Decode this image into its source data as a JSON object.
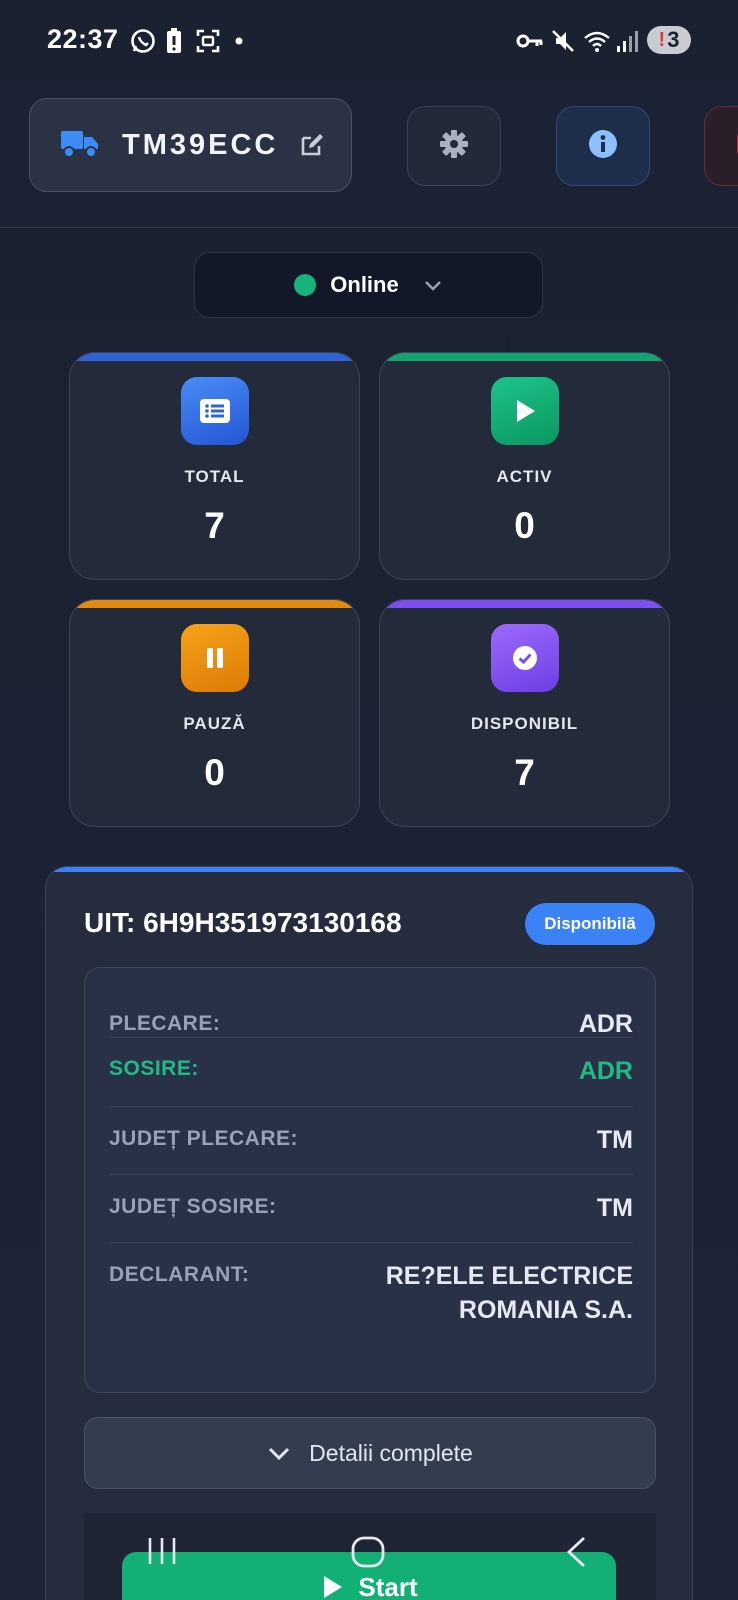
{
  "status_bar": {
    "time": "22:37",
    "notification_count": "3",
    "icons": [
      "whatsapp-icon",
      "battery-saver-icon",
      "screenshot-icon",
      "dot-icon",
      "vpn-key-icon",
      "mute-icon",
      "wifi-icon",
      "signal-icon"
    ]
  },
  "header": {
    "vehicle_plate": "TM39ECC",
    "vehicle_icon": "truck-icon",
    "edit_icon": "edit-icon",
    "settings_icon": "gear-icon",
    "info_icon": "info-icon",
    "logout_icon": "logout-icon"
  },
  "connection": {
    "status_label": "Online",
    "status_color": "#16b37a"
  },
  "stats": [
    {
      "label": "TOTAL",
      "value": "7",
      "color": "#3b82f6",
      "icon": "list-icon"
    },
    {
      "label": "ACTIV",
      "value": "0",
      "color": "#10b981",
      "icon": "play-icon"
    },
    {
      "label": "PAUZĂ",
      "value": "0",
      "color": "#f59e0b",
      "icon": "pause-icon"
    },
    {
      "label": "DISPONIBIL",
      "value": "7",
      "color": "#8b5cf6",
      "icon": "check-circle-icon"
    }
  ],
  "uit_card": {
    "title": "UIT: 6H9H351973130168",
    "badge": "Disponibilă",
    "rows": [
      {
        "label": "PLECARE:",
        "value": "ADR"
      },
      {
        "label": "SOSIRE:",
        "value": "ADR"
      },
      {
        "label": "JUDEȚ PLECARE:",
        "value": "TM"
      },
      {
        "label": "JUDEȚ SOSIRE:",
        "value": "TM"
      },
      {
        "label": "DECLARANT:",
        "value_line1": "RE?ELE ELECTRICE",
        "value_line2": "ROMANIA S.A."
      }
    ],
    "details_button": "Detalii complete",
    "start_button": "Start"
  },
  "colors": {
    "accent_blue": "#3b82f6",
    "accent_green": "#12b075",
    "background": "#1b2232"
  }
}
